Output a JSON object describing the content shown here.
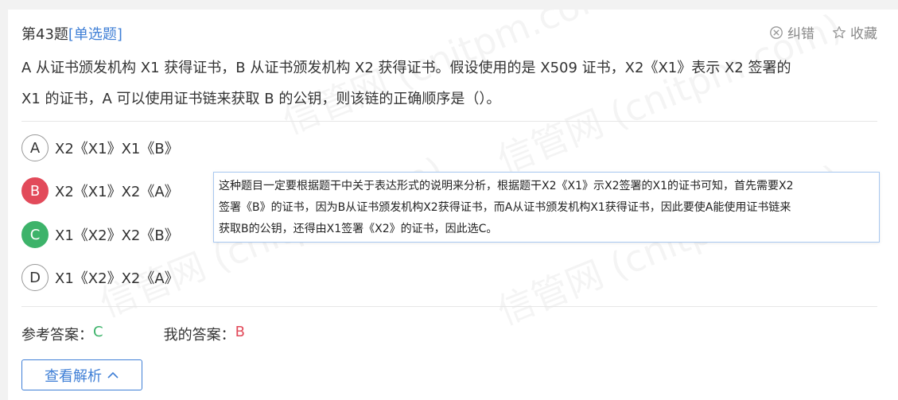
{
  "question": {
    "number_label": "第43题",
    "type_label": "[单选题]",
    "stem_line1": "A 从证书颁发机构 X1 获得证书，B 从证书颁发机构 X2 获得证书。假设使用的是 X509 证书，X2《X1》表示 X2 签署的",
    "stem_line2": "X1 的证书，A 可以使用证书链来获取 B 的公钥，则该链的正确顺序是（）。"
  },
  "actions": {
    "correct_label": "纠错",
    "favorite_label": "收藏"
  },
  "options": [
    {
      "letter": "A",
      "text": "X2《X1》X1《B》",
      "state": "normal"
    },
    {
      "letter": "B",
      "text": "X2《X1》X2《A》",
      "state": "wrong"
    },
    {
      "letter": "C",
      "text": "X1《X2》X2《B》",
      "state": "right"
    },
    {
      "letter": "D",
      "text": "X1《X2》X2《A》",
      "state": "normal"
    }
  ],
  "tooltip": {
    "line1": "这种题目一定要根据题干中关于表达形式的说明来分析，根据题干X2《X1》示X2签署的X1的证书可知，首先需要X2",
    "line2": "签署《B》的证书，因为B从证书颁发机构X2获得证书，而A从证书颁发机构X1获得证书，因此要使A能使用证书链来",
    "line3": "获取B的公钥，还得由X1签署《X2》的证书，因此选C。"
  },
  "answers": {
    "reference_label": "参考答案：",
    "reference_value": "C",
    "mine_label": "我的答案：",
    "mine_value": "B"
  },
  "analysis_button_label": "查看解析",
  "colors": {
    "accent": "#3f7fd6",
    "wrong": "#e24a5a",
    "right": "#3db36a"
  }
}
